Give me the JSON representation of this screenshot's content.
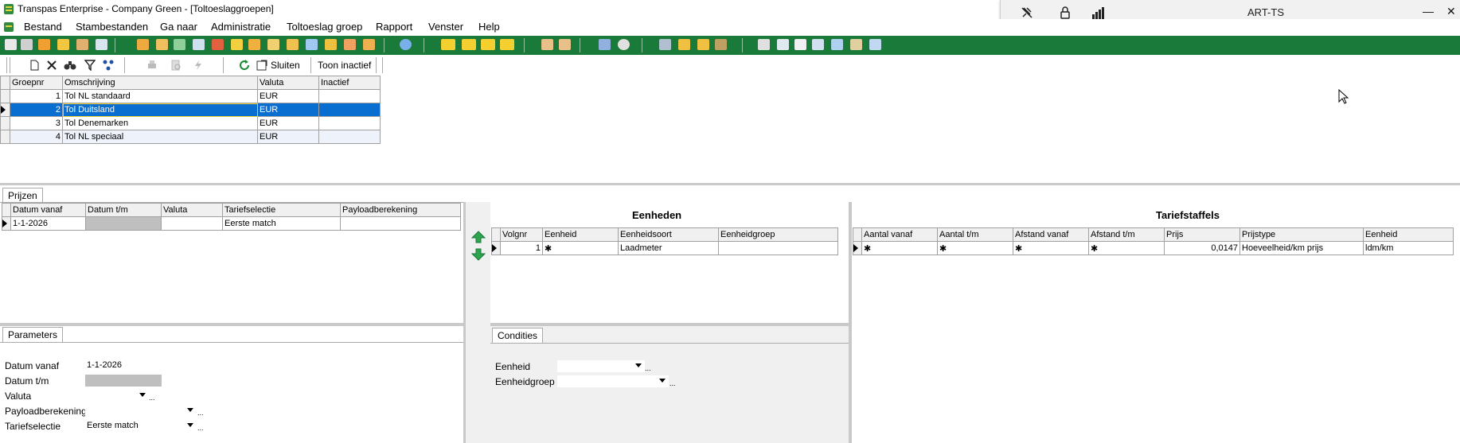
{
  "window": {
    "title": "Transpas Enterprise - Company Green - [Toltoeslaggroepen]",
    "remote_title": "ART-TS",
    "minimize": "—",
    "close": "✕"
  },
  "menu": [
    {
      "label": "Bestand"
    },
    {
      "label": "Stambestanden"
    },
    {
      "label": "Ga naar"
    },
    {
      "label": "Administratie"
    },
    {
      "label": "Toltoeslag groep"
    },
    {
      "label": "Rapport"
    },
    {
      "label": "Venster"
    },
    {
      "label": "Help"
    }
  ],
  "toolbar2": {
    "close_label": "Sluiten",
    "show_inactive_label": "Toon inactief"
  },
  "groups": {
    "columns": [
      "Groepnr",
      "Omschrijving",
      "Valuta",
      "Inactief"
    ],
    "rows": [
      {
        "nr": "1",
        "desc": "Tol NL standaard",
        "cur": "EUR",
        "inactive": ""
      },
      {
        "nr": "2",
        "desc": "Tol Duitsland",
        "cur": "EUR",
        "inactive": ""
      },
      {
        "nr": "3",
        "desc": "Tol Denemarken",
        "cur": "EUR",
        "inactive": ""
      },
      {
        "nr": "4",
        "desc": "Tol NL speciaal",
        "cur": "EUR",
        "inactive": ""
      }
    ]
  },
  "prijzen": {
    "tab": "Prijzen",
    "columns": [
      "Datum vanaf",
      "Datum t/m",
      "Valuta",
      "Tariefselectie",
      "Payloadberekening"
    ],
    "rows": [
      {
        "from": "1-1-2026",
        "to": "",
        "cur": "",
        "sel": "Eerste match",
        "payload": ""
      }
    ]
  },
  "parameters": {
    "tab": "Parameters",
    "datum_vanaf_label": "Datum vanaf",
    "datum_vanaf_value": "1-1-2026",
    "datum_tm_label": "Datum t/m",
    "valuta_label": "Valuta",
    "payload_label": "Payloadberekening",
    "tariefselectie_label": "Tariefselectie",
    "tariefselectie_value": "Eerste match"
  },
  "eenheden": {
    "title": "Eenheden",
    "columns": [
      "Volgnr",
      "Eenheid",
      "Eenheidsoort",
      "Eenheidgroep"
    ],
    "rows": [
      {
        "nr": "1",
        "eenheid": "✱",
        "soort": "Laadmeter",
        "groep": ""
      }
    ]
  },
  "condities": {
    "tab": "Condities",
    "eenheid_label": "Eenheid",
    "eenheidgroep_label": "Eenheidgroep"
  },
  "tariefstaffels": {
    "title": "Tariefstaffels",
    "columns": [
      "Aantal vanaf",
      "Aantal t/m",
      "Afstand vanaf",
      "Afstand t/m",
      "Prijs",
      "Prijstype",
      "Eenheid"
    ],
    "rows": [
      {
        "a_from": "✱",
        "a_to": "✱",
        "d_from": "✱",
        "d_to": "✱",
        "price": "0,0147",
        "type": "Hoeveelheid/km prijs",
        "unit": "ldm/km"
      }
    ]
  },
  "colors": {
    "toolbar_green": "#1a7a3a",
    "selection_blue": "#0a6ed1"
  }
}
